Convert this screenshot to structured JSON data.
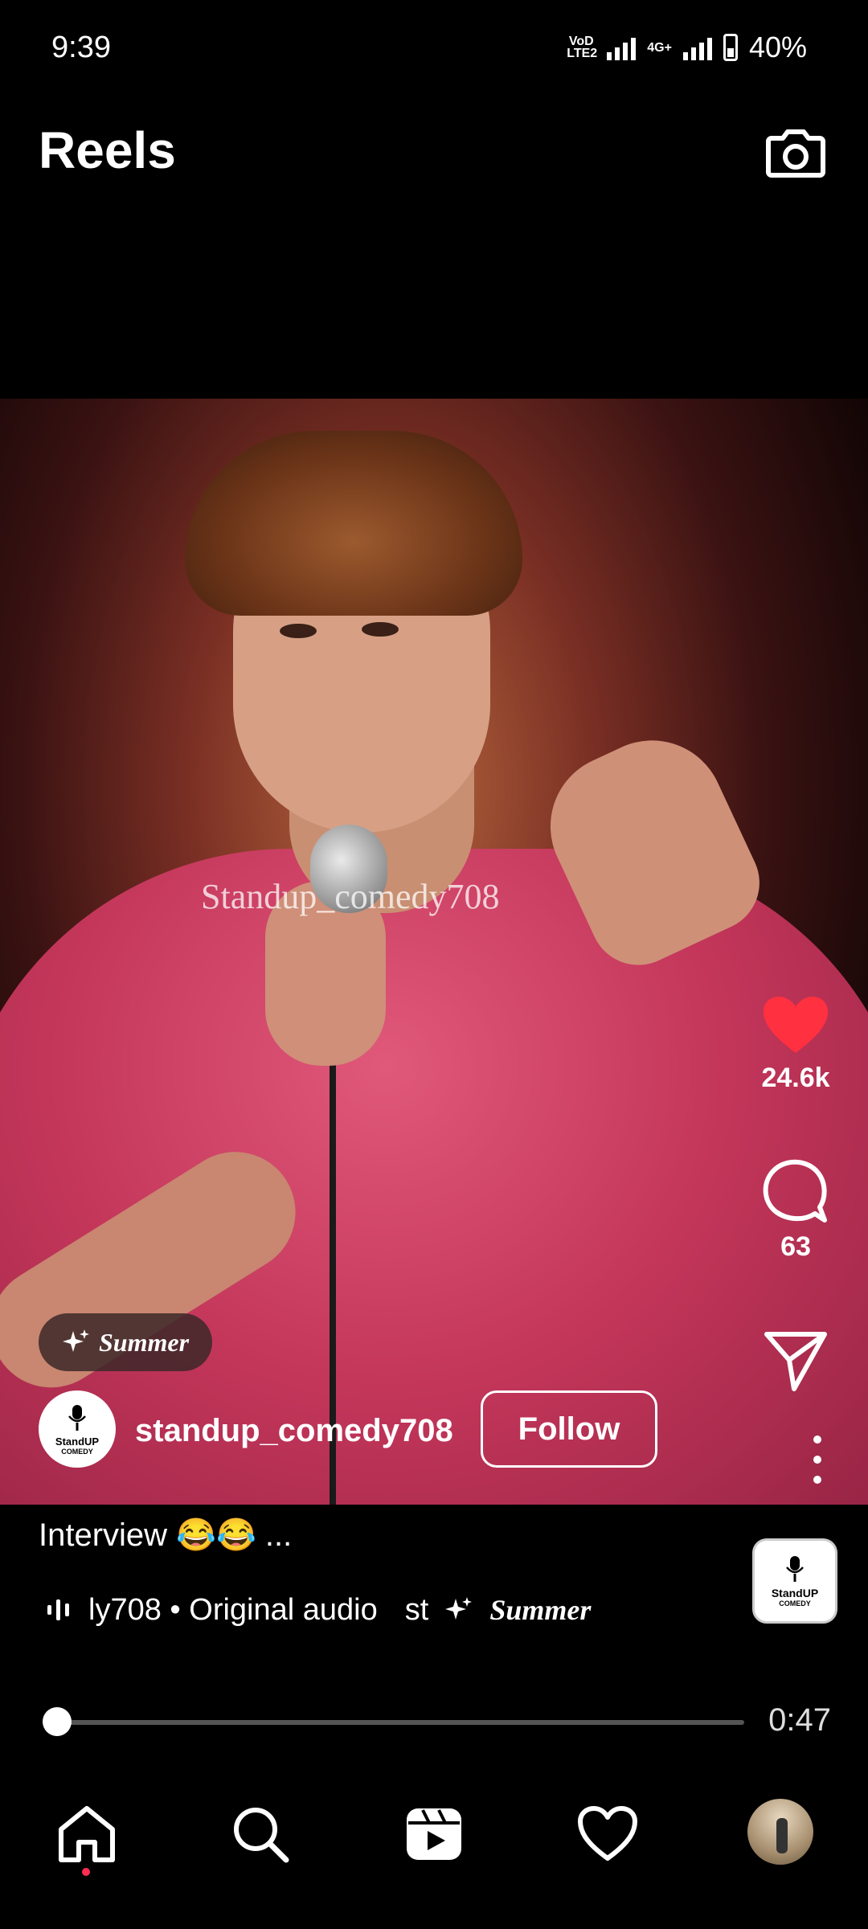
{
  "status_bar": {
    "time": "9:39",
    "network_1": "VoD LTE2",
    "network_2": "4G+",
    "battery": "40%"
  },
  "header": {
    "title": "Reels",
    "camera_icon": "camera-icon"
  },
  "video": {
    "watermark": "Standup_comedy708"
  },
  "filter": {
    "label": "Summer",
    "icon": "sparkles-icon"
  },
  "author": {
    "username": "standup_comedy708",
    "follow_label": "Follow",
    "avatar_line1": "StandUP",
    "avatar_line2": "COMEDY"
  },
  "actions": {
    "likes": "24.6k",
    "comments": "63",
    "like_color": "#ff3040"
  },
  "caption": {
    "text": "Interview 😂😂 ..."
  },
  "audio": {
    "text": "ly708 • Original audio",
    "effect_prefix": "st",
    "effect_label": "Summer",
    "thumb_line1": "StandUP",
    "thumb_line2": "COMEDY"
  },
  "playback": {
    "time_remaining": "0:47",
    "progress": 0.01
  },
  "nav": {
    "items": [
      "home-icon",
      "search-icon",
      "reels-icon",
      "heart-icon",
      "profile-avatar"
    ]
  }
}
